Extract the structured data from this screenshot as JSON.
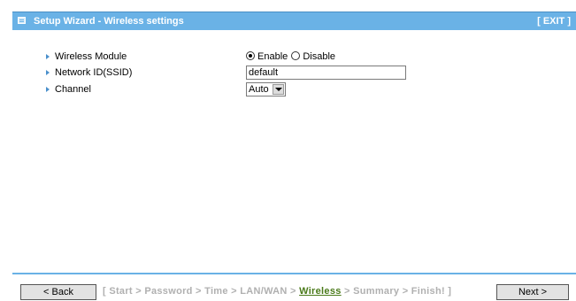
{
  "header": {
    "title": "Setup Wizard - Wireless settings",
    "exit_label": "[ EXIT ]"
  },
  "form": {
    "wireless_module": {
      "label": "Wireless Module",
      "options": [
        "Enable",
        "Disable"
      ],
      "selected": "Enable"
    },
    "ssid": {
      "label": "Network ID(SSID)",
      "value": "default"
    },
    "channel": {
      "label": "Channel",
      "value": "Auto"
    }
  },
  "footer": {
    "back_label": "< Back",
    "next_label": "Next >",
    "steps_open": "[ ",
    "steps_before": "Start > Password > Time > LAN/WAN > ",
    "current_step": "Wireless",
    "steps_after": " > Summary > Finish! ]"
  },
  "colors": {
    "title_bar": "#6ab2e6",
    "current_step": "#4a7a1a",
    "inactive_step": "#b0b0b0"
  }
}
